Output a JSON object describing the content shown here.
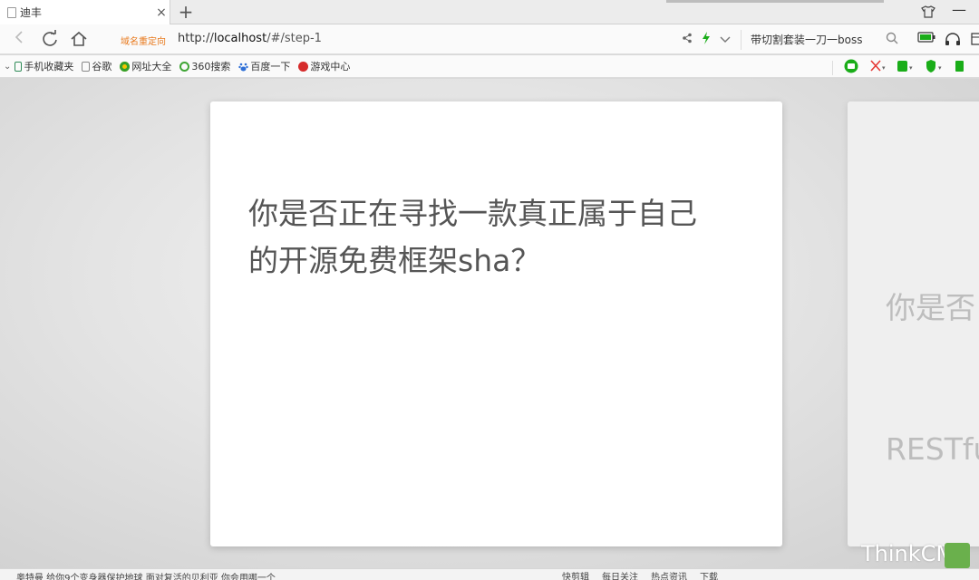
{
  "tab": {
    "title": "迪丰",
    "close_glyph": "×",
    "new_glyph": "+"
  },
  "window": {
    "minimize_glyph": "—"
  },
  "address": {
    "redirect_label": "域名重定向",
    "url_prefix": "http://",
    "url_host": "localhost",
    "url_rest": "/#/step-1",
    "search_text": "带切割套装一刀一boss"
  },
  "bookmarks": [
    {
      "label": "手机收藏夹",
      "color": "#2e8b57"
    },
    {
      "label": "谷歌",
      "color": "#888888"
    },
    {
      "label": "网址大全",
      "color": "#33a02c"
    },
    {
      "label": "360搜索",
      "color": "#3fa535"
    },
    {
      "label": "百度一下",
      "color": "#2f6fd6"
    },
    {
      "label": "游戏中心",
      "color": "#d62b2b"
    }
  ],
  "slide": {
    "line1": "你是否正在寻找一款真正属于自己",
    "line2": "的开源免费框架sha？"
  },
  "next_slide": {
    "line1": "你是否",
    "line2": "RESTfu"
  },
  "watermark": "ThinkCMF",
  "statusbar": {
    "news": "奥特曼 给你9个变身器保护地球 面对复活的贝利亚 你会用哪一个",
    "items": [
      "快剪辑",
      "每日关注",
      "热点资讯",
      "下载"
    ]
  },
  "colors": {
    "accent_green": "#1aad19",
    "redirect_orange": "#e87a1e"
  }
}
